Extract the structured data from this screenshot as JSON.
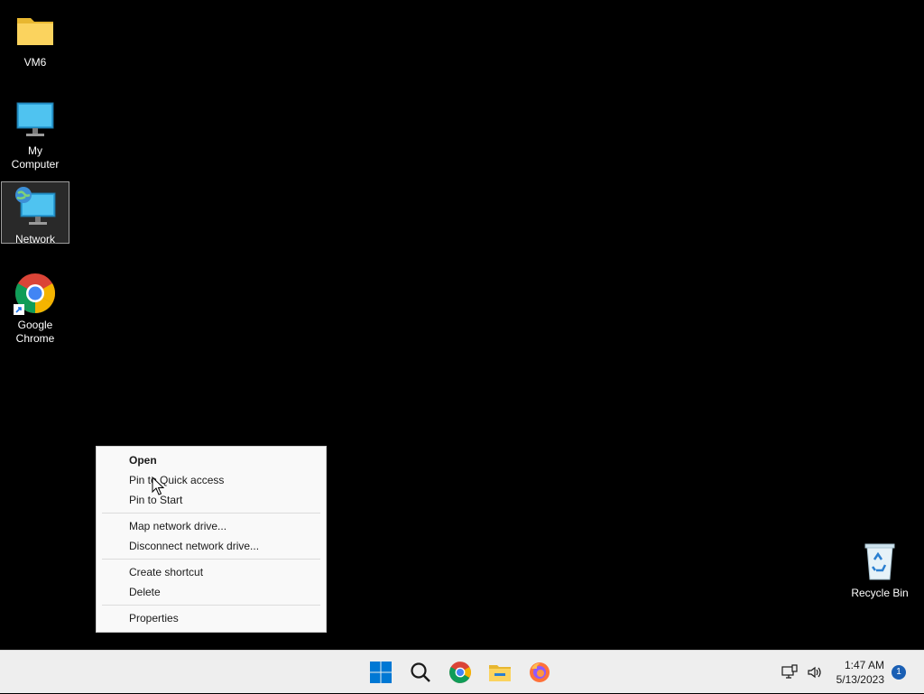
{
  "desktop": {
    "icons": [
      {
        "label": "VM6",
        "icon": "folder-icon"
      },
      {
        "label": "My Computer",
        "icon": "computer-icon"
      },
      {
        "label": "Network",
        "icon": "network-icon",
        "selected": true
      },
      {
        "label": "Google Chrome",
        "icon": "chrome-icon",
        "shortcut": true
      },
      {
        "label": "Recycle Bin",
        "icon": "recycle-bin-icon"
      }
    ]
  },
  "context_menu": {
    "items": [
      {
        "label": "Open",
        "bold": true
      },
      {
        "label": "Pin to Quick access"
      },
      {
        "label": "Pin to Start"
      },
      {
        "label": "Map network drive..."
      },
      {
        "label": "Disconnect network drive..."
      },
      {
        "label": "Create shortcut"
      },
      {
        "label": "Delete"
      },
      {
        "label": "Properties"
      }
    ]
  },
  "taskbar": {
    "apps": [
      "start-icon",
      "search-icon",
      "chrome-icon",
      "file-explorer-icon",
      "firefox-icon"
    ],
    "tray": {
      "time": "1:47 AM",
      "date": "5/13/2023",
      "notification_count": "1"
    }
  },
  "colors": {
    "desktop_bg": "#000000",
    "taskbar_bg": "#eeeeee",
    "menu_bg": "#f9f9f9",
    "accent": "#0078d4"
  }
}
